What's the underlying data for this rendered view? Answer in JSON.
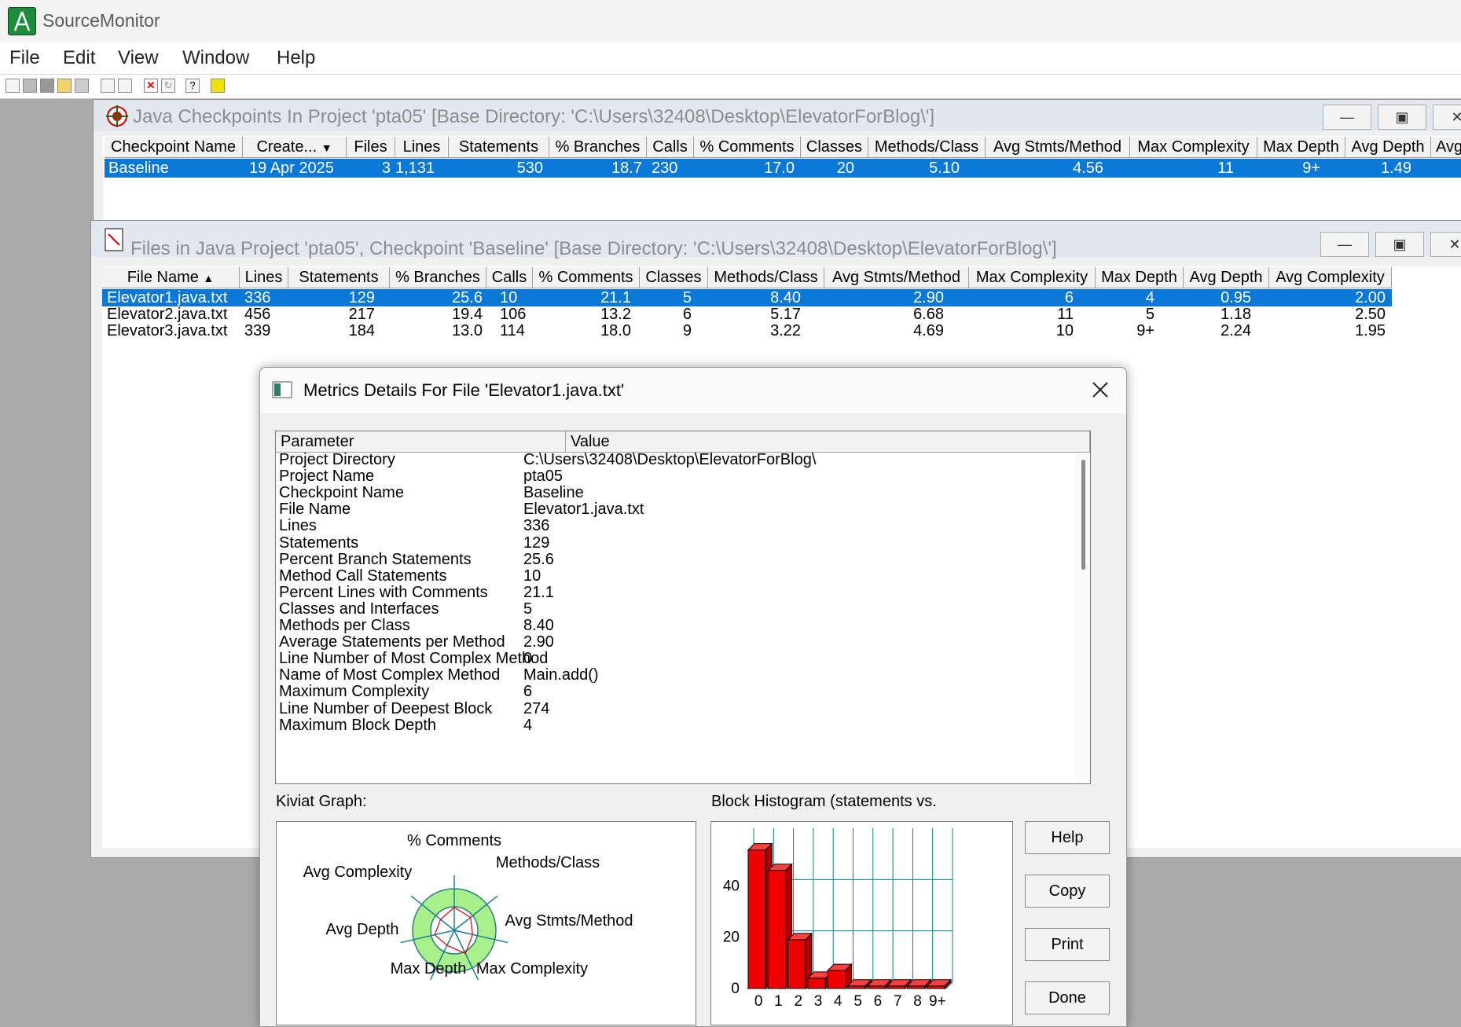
{
  "app": {
    "title": "SourceMonitor"
  },
  "menu": [
    "File",
    "Edit",
    "View",
    "Window",
    "Help"
  ],
  "colors": {
    "selection": "#0a78d7",
    "histogram_bar": "#ee0000",
    "grid": "#0a7f8a",
    "kiviat_ring": "#a8f08a"
  },
  "checkpoints": {
    "title": "Java Checkpoints In Project 'pta05'  [Base Directory: 'C:\\Users\\32408\\Desktop\\ElevatorForBlog\\']",
    "columns": [
      "Checkpoint Name",
      "Create...",
      "Files",
      "Lines",
      "Statements",
      "% Branches",
      "Calls",
      "% Comments",
      "Classes",
      "Methods/Class",
      "Avg Stmts/Method",
      "Max Complexity",
      "Max Depth",
      "Avg Depth",
      "Avg C"
    ],
    "rows": [
      [
        "Baseline",
        "19 Apr 2025",
        "3",
        "1,131",
        "530",
        "18.7",
        "230",
        "17.0",
        "20",
        "5.10",
        "4.56",
        "11",
        "9+",
        "1.49"
      ]
    ]
  },
  "files": {
    "title": "Files in Java Project 'pta05', Checkpoint 'Baseline'  [Base Directory: 'C:\\Users\\32408\\Desktop\\ElevatorForBlog\\']",
    "columns": [
      "File Name",
      "Lines",
      "Statements",
      "% Branches",
      "Calls",
      "% Comments",
      "Classes",
      "Methods/Class",
      "Avg Stmts/Method",
      "Max Complexity",
      "Max Depth",
      "Avg Depth",
      "Avg Complexity"
    ],
    "rows": [
      [
        "Elevator1.java.txt",
        "336",
        "129",
        "25.6",
        "10",
        "21.1",
        "5",
        "8.40",
        "2.90",
        "6",
        "4",
        "0.95",
        "2.00"
      ],
      [
        "Elevator2.java.txt",
        "456",
        "217",
        "19.4",
        "106",
        "13.2",
        "6",
        "5.17",
        "6.68",
        "11",
        "5",
        "1.18",
        "2.50"
      ],
      [
        "Elevator3.java.txt",
        "339",
        "184",
        "13.0",
        "114",
        "18.0",
        "9",
        "3.22",
        "4.69",
        "10",
        "9+",
        "2.24",
        "1.95"
      ]
    ]
  },
  "dialog": {
    "title": "Metrics Details For File 'Elevator1.java.txt'",
    "param_header": "Parameter",
    "value_header": "Value",
    "rows": [
      [
        "Project Directory",
        "C:\\Users\\32408\\Desktop\\ElevatorForBlog\\"
      ],
      [
        "Project Name",
        "pta05"
      ],
      [
        "Checkpoint Name",
        "Baseline"
      ],
      [
        "File Name",
        "Elevator1.java.txt"
      ],
      [
        "Lines",
        "336"
      ],
      [
        "Statements",
        "129"
      ],
      [
        "Percent Branch Statements",
        "25.6"
      ],
      [
        "Method Call Statements",
        "10"
      ],
      [
        "Percent Lines with Comments",
        "21.1"
      ],
      [
        "Classes and Interfaces",
        "5"
      ],
      [
        "Methods per Class",
        "8.40"
      ],
      [
        "Average Statements per Method",
        "2.90"
      ],
      [
        "Line Number of Most Complex Method",
        "0"
      ],
      [
        "Name of Most Complex Method",
        "Main.add()"
      ],
      [
        "Maximum Complexity",
        "6"
      ],
      [
        "Line Number of Deepest Block",
        "274"
      ],
      [
        "Maximum Block Depth",
        "4"
      ]
    ],
    "kiviat_label": "Kiviat Graph:",
    "histogram_label": "Block Histogram (statements vs.",
    "buttons": {
      "help": "Help",
      "copy": "Copy",
      "print": "Print",
      "done": "Done"
    }
  },
  "kiviat_axes": [
    "% Comments",
    "Methods/Class",
    "Avg Stmts/Method",
    "Max Complexity",
    "Max Depth",
    "Avg Depth",
    "Avg Complexity"
  ],
  "chart_data": {
    "type": "bar",
    "categories": [
      "0",
      "1",
      "2",
      "3",
      "4",
      "5",
      "6",
      "7",
      "8",
      "9+"
    ],
    "values": [
      54,
      46,
      19,
      4,
      7,
      1,
      1,
      1,
      1,
      1
    ],
    "ylim": [
      0,
      60
    ],
    "yticks": [
      "0",
      "20",
      "40"
    ],
    "grid": true
  }
}
